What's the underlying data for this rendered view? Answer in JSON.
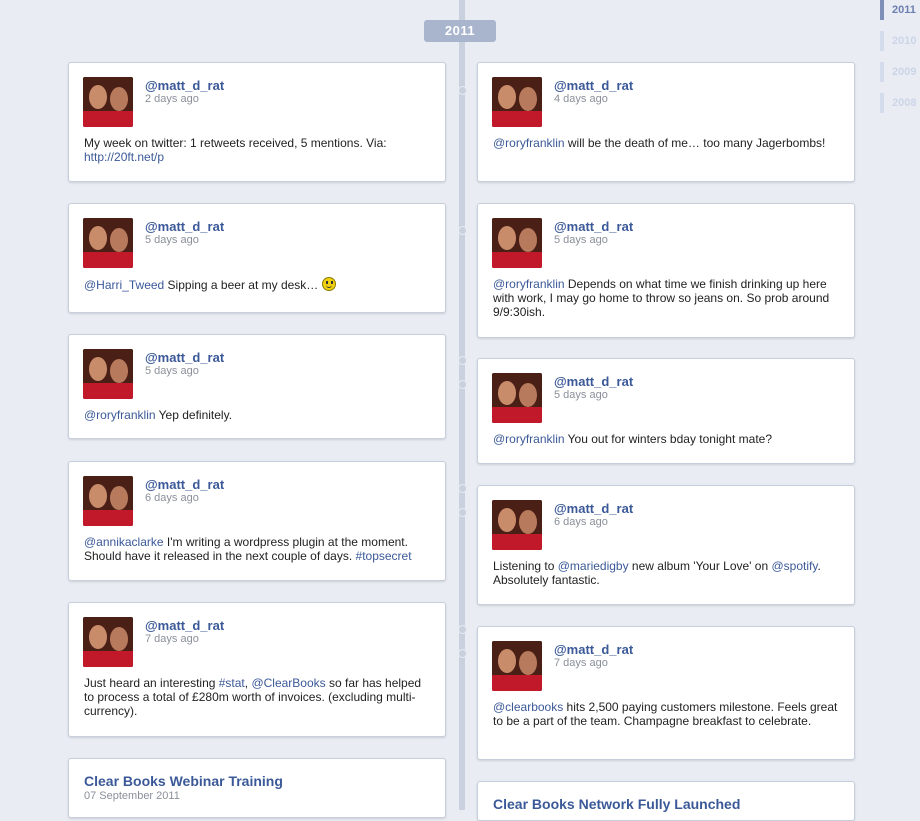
{
  "timeline": {
    "current_year": "2011",
    "years": [
      "2011",
      "2010",
      "2009",
      "2008"
    ]
  },
  "colors": {
    "link": "#3b5998",
    "spine": "#c9d0de",
    "background": "#e9ecf3"
  },
  "left": [
    {
      "user": "@matt_d_rat",
      "time": "2 days ago",
      "parts": [
        {
          "t": "My week on twitter: 1 retweets received, 5 mentions. Via: "
        },
        {
          "t": "http://20ft.net/p",
          "link": true
        }
      ]
    },
    {
      "user": "@matt_d_rat",
      "time": "5 days ago",
      "parts": [
        {
          "t": "@Harri_Tweed",
          "link": true
        },
        {
          "t": " Sipping a beer at my desk… "
        }
      ],
      "emoticon": "smiley-icon"
    },
    {
      "user": "@matt_d_rat",
      "time": "5 days ago",
      "parts": [
        {
          "t": "@roryfranklin",
          "link": true
        },
        {
          "t": " Yep definitely."
        }
      ]
    },
    {
      "user": "@matt_d_rat",
      "time": "6 days ago",
      "parts": [
        {
          "t": "@annikaclarke",
          "link": true
        },
        {
          "t": " I'm writing a wordpress plugin at the moment. Should have it released in the next couple of days. "
        },
        {
          "t": "#topsecret",
          "link": true
        }
      ]
    },
    {
      "user": "@matt_d_rat",
      "time": "7 days ago",
      "parts": [
        {
          "t": "Just heard an interesting "
        },
        {
          "t": "#stat",
          "link": true
        },
        {
          "t": ", "
        },
        {
          "t": "@ClearBooks",
          "link": true
        },
        {
          "t": " so far has helped to process a total of £280m worth of invoices. (excluding multi-currency)."
        }
      ]
    }
  ],
  "right": [
    {
      "user": "@matt_d_rat",
      "time": "4 days ago",
      "parts": [
        {
          "t": "@roryfranklin",
          "link": true
        },
        {
          "t": " will be the death of me… too many Jagerbombs!"
        }
      ]
    },
    {
      "user": "@matt_d_rat",
      "time": "5 days ago",
      "parts": [
        {
          "t": "@roryfranklin",
          "link": true
        },
        {
          "t": " Depends on what time we finish drinking up here with work, I may go home to throw so jeans on. So prob around 9/9:30ish."
        }
      ]
    },
    {
      "user": "@matt_d_rat",
      "time": "5 days ago",
      "parts": [
        {
          "t": "@roryfranklin",
          "link": true
        },
        {
          "t": " You out for winters bday tonight mate?"
        }
      ]
    },
    {
      "user": "@matt_d_rat",
      "time": "6 days ago",
      "parts": [
        {
          "t": "Listening to "
        },
        {
          "t": "@mariedigby",
          "link": true
        },
        {
          "t": " new album 'Your Love' on "
        },
        {
          "t": "@spotify",
          "link": true
        },
        {
          "t": ". Absolutely fantastic."
        }
      ]
    },
    {
      "user": "@matt_d_rat",
      "time": "7 days ago",
      "parts": [
        {
          "t": "@clearbooks",
          "link": true
        },
        {
          "t": " hits 2,500 paying customers milestone. Feels great to be a part of the team. Champagne breakfast to celebrate."
        }
      ]
    }
  ],
  "events": {
    "left": {
      "title": "Clear Books Webinar Training",
      "date": "07 September 2011"
    },
    "right": {
      "title": "Clear Books Network Fully Launched"
    }
  }
}
